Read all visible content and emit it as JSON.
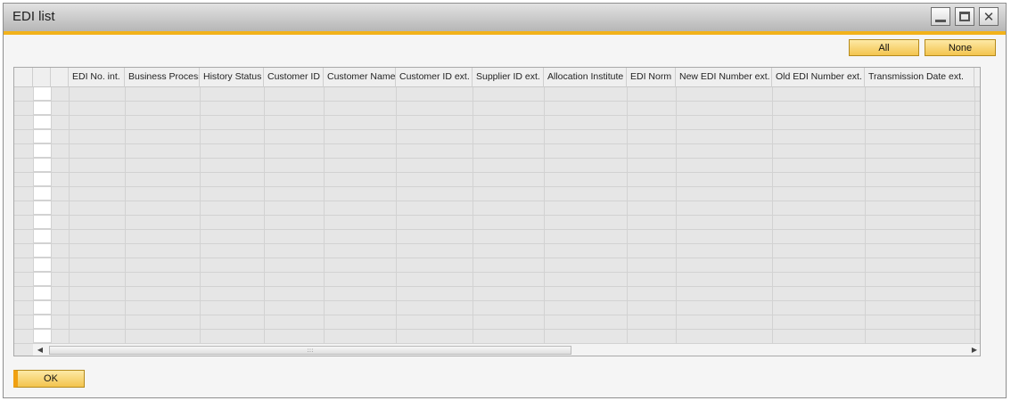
{
  "window": {
    "title": "EDI list"
  },
  "toolbar": {
    "all_label": "All",
    "none_label": "None"
  },
  "grid": {
    "columns": [
      "EDI No. int.",
      "Business Process",
      "History Status",
      "Customer ID",
      "Customer Name",
      "Customer ID ext.",
      "Supplier ID ext.",
      "Allocation Institute",
      "EDI Norm",
      "New EDI Number ext.",
      "Old EDI Number ext.",
      "Transmission Date ext."
    ],
    "rows": []
  },
  "footer": {
    "ok_label": "OK"
  },
  "colors": {
    "accent": "#f2b21a",
    "button": "#f3c44e"
  }
}
